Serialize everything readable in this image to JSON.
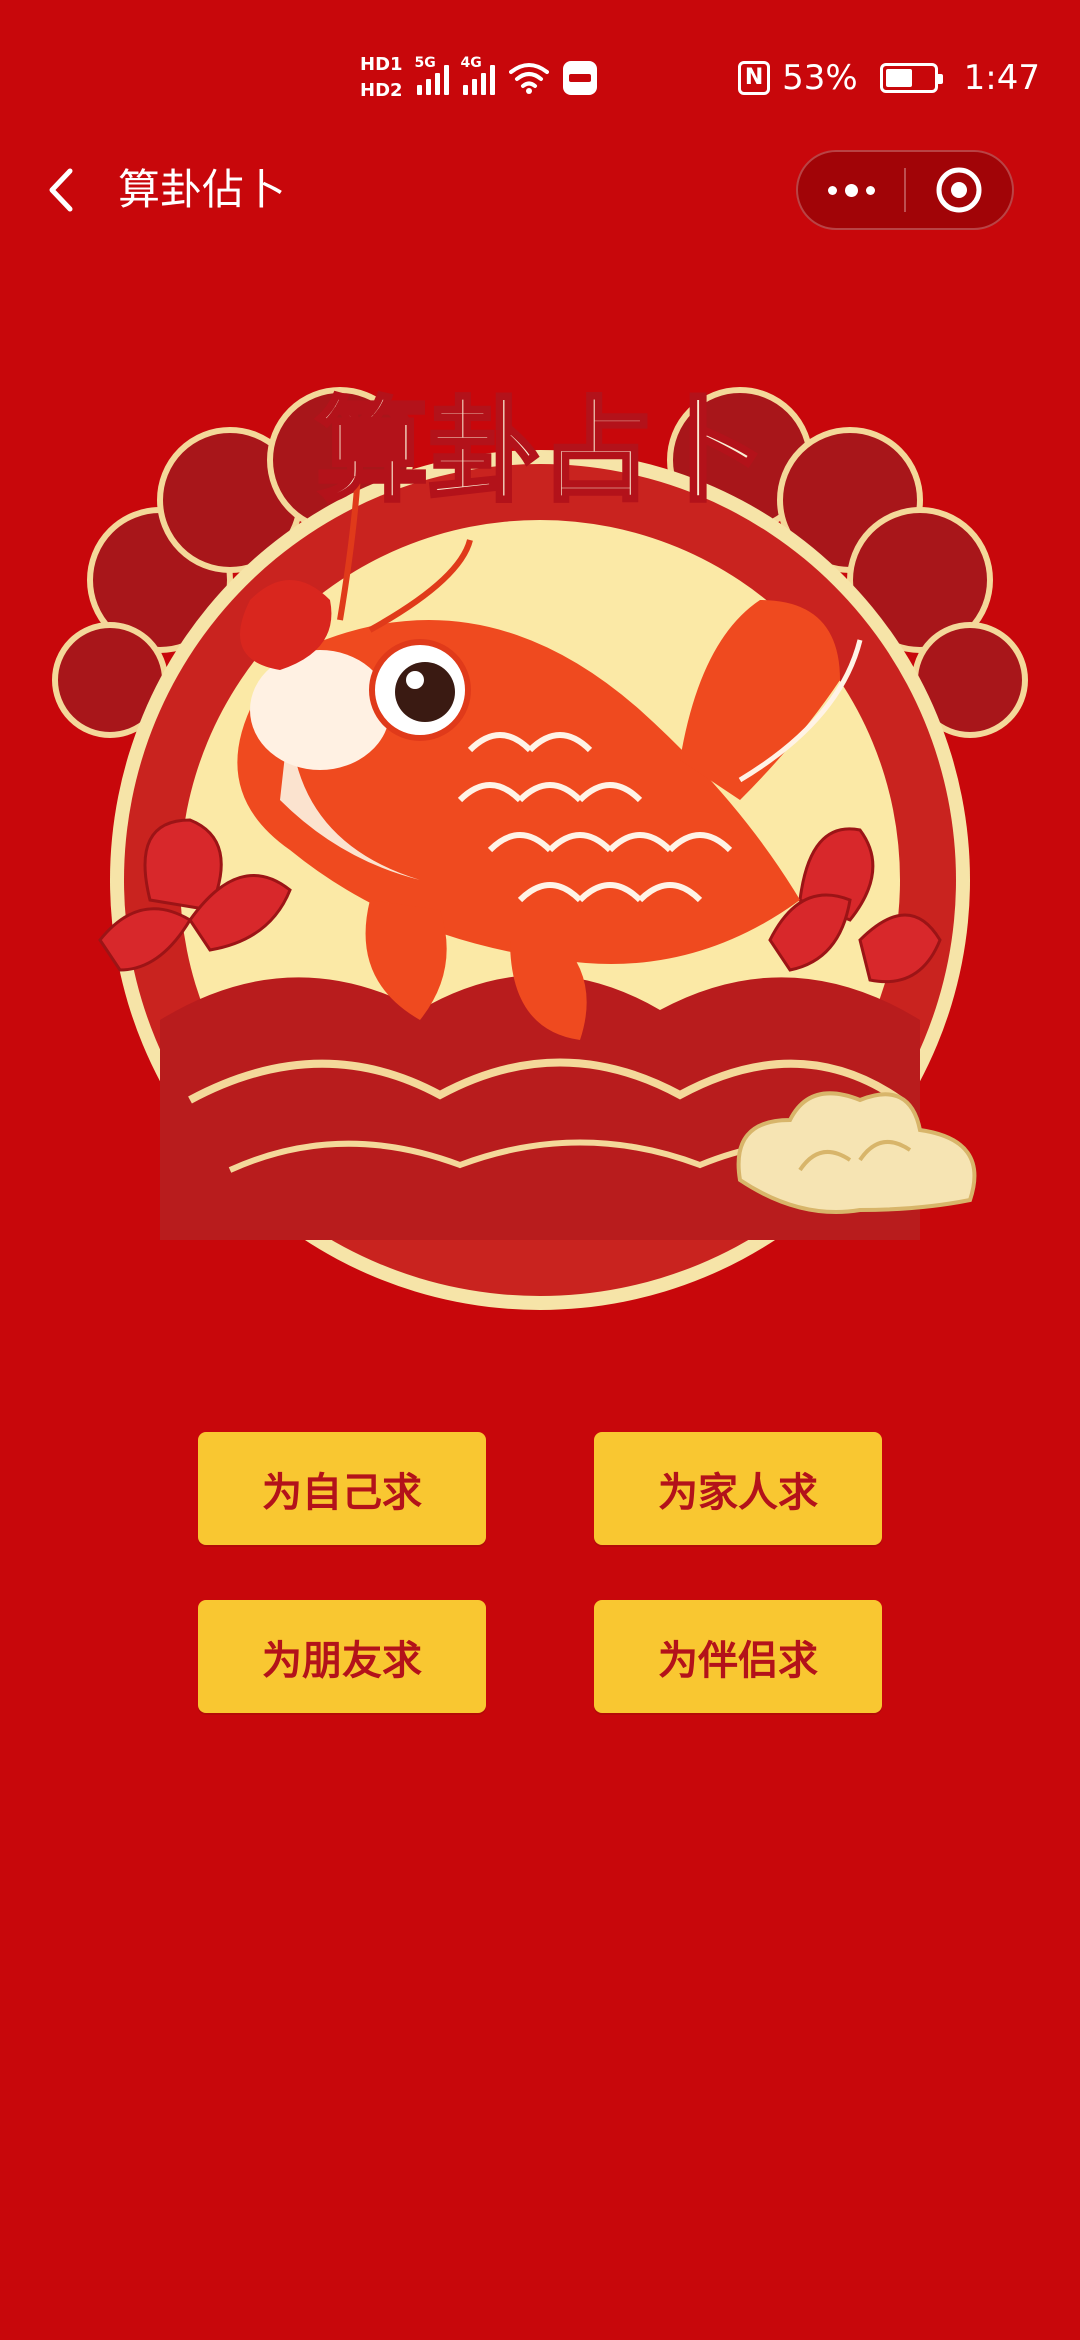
{
  "status_bar": {
    "hd1": "HD1",
    "hd2": "HD2",
    "network_1": "5G",
    "network_2": "4G",
    "nfc": "N",
    "battery": "53%",
    "time": "1:47"
  },
  "nav": {
    "title": "算卦佔卜"
  },
  "hero": {
    "banner_text": "算卦占卜"
  },
  "options": [
    {
      "label": "为自己求"
    },
    {
      "label": "为家人求"
    },
    {
      "label": "为朋友求"
    },
    {
      "label": "为伴侣求"
    }
  ],
  "colors": {
    "background": "#c8070b",
    "button": "#f9c731",
    "button_text": "#b3121a",
    "moon": "#fbe9a6"
  }
}
